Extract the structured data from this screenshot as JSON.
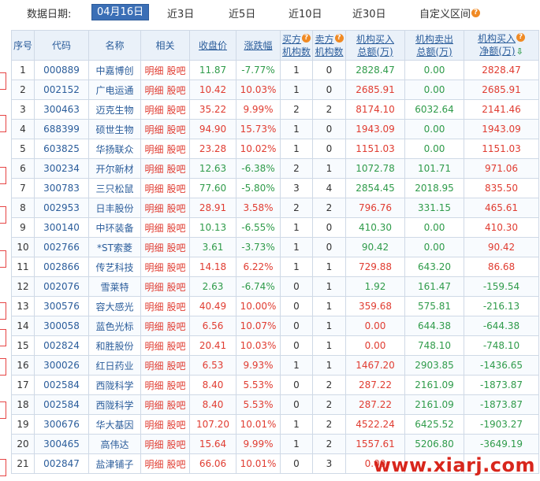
{
  "topbar": {
    "label": "数据日期:",
    "options": [
      {
        "label": "04月16日",
        "active": true
      },
      {
        "label": "近3日",
        "active": false
      },
      {
        "label": "近5日",
        "active": false
      },
      {
        "label": "近10日",
        "active": false
      },
      {
        "label": "近30日",
        "active": false
      },
      {
        "label": "自定义区间",
        "active": false
      }
    ]
  },
  "table": {
    "headers": {
      "seq": "序号",
      "code": "代码",
      "name": "名称",
      "related": "相关",
      "close": "收盘价",
      "change": "涨跌幅",
      "buy_count_1": "买方",
      "buy_count_2": "机构数",
      "sell_count_1": "卖方",
      "sell_count_2": "机构数",
      "buy_amt_1": "机构买入",
      "buy_amt_2": "总额(万)",
      "sell_amt_1": "机构卖出",
      "sell_amt_2": "总额(万)",
      "net_1": "机构买入",
      "net_2": "净额(万)"
    },
    "related_links": [
      "明细",
      "股吧"
    ],
    "rows": [
      {
        "seq": "1",
        "code": "000889",
        "name": "中嘉博创",
        "close": "11.87",
        "change": "-7.77%",
        "buyers": "1",
        "sellers": "0",
        "buy": "2828.47",
        "sell": "0.00",
        "net": "2828.47"
      },
      {
        "seq": "2",
        "code": "002152",
        "name": "广电运通",
        "close": "10.42",
        "change": "10.03%",
        "buyers": "1",
        "sellers": "0",
        "buy": "2685.91",
        "sell": "0.00",
        "net": "2685.91"
      },
      {
        "seq": "3",
        "code": "300463",
        "name": "迈克生物",
        "close": "35.22",
        "change": "9.99%",
        "buyers": "2",
        "sellers": "2",
        "buy": "8174.10",
        "sell": "6032.64",
        "net": "2141.46"
      },
      {
        "seq": "4",
        "code": "688399",
        "name": "硕世生物",
        "close": "94.90",
        "change": "15.73%",
        "buyers": "1",
        "sellers": "0",
        "buy": "1943.09",
        "sell": "0.00",
        "net": "1943.09"
      },
      {
        "seq": "5",
        "code": "603825",
        "name": "华扬联众",
        "close": "23.28",
        "change": "10.02%",
        "buyers": "1",
        "sellers": "0",
        "buy": "1151.03",
        "sell": "0.00",
        "net": "1151.03"
      },
      {
        "seq": "6",
        "code": "300234",
        "name": "开尔新材",
        "close": "12.63",
        "change": "-6.38%",
        "buyers": "2",
        "sellers": "1",
        "buy": "1072.78",
        "sell": "101.71",
        "net": "971.06"
      },
      {
        "seq": "7",
        "code": "300783",
        "name": "三只松鼠",
        "close": "77.60",
        "change": "-5.80%",
        "buyers": "3",
        "sellers": "4",
        "buy": "2854.45",
        "sell": "2018.95",
        "net": "835.50"
      },
      {
        "seq": "8",
        "code": "002953",
        "name": "日丰股份",
        "close": "28.91",
        "change": "3.58%",
        "buyers": "2",
        "sellers": "2",
        "buy": "796.76",
        "sell": "331.15",
        "net": "465.61"
      },
      {
        "seq": "9",
        "code": "300140",
        "name": "中环装备",
        "close": "10.13",
        "change": "-6.55%",
        "buyers": "1",
        "sellers": "0",
        "buy": "410.30",
        "sell": "0.00",
        "net": "410.30"
      },
      {
        "seq": "10",
        "code": "002766",
        "name": "*ST索菱",
        "close": "3.61",
        "change": "-3.73%",
        "buyers": "1",
        "sellers": "0",
        "buy": "90.42",
        "sell": "0.00",
        "net": "90.42"
      },
      {
        "seq": "11",
        "code": "002866",
        "name": "传艺科技",
        "close": "14.18",
        "change": "6.22%",
        "buyers": "1",
        "sellers": "1",
        "buy": "729.88",
        "sell": "643.20",
        "net": "86.68"
      },
      {
        "seq": "12",
        "code": "002076",
        "name": "雪莱特",
        "close": "2.63",
        "change": "-6.74%",
        "buyers": "0",
        "sellers": "1",
        "buy": "1.92",
        "sell": "161.47",
        "net": "-159.54"
      },
      {
        "seq": "13",
        "code": "300576",
        "name": "容大感光",
        "close": "40.49",
        "change": "10.00%",
        "buyers": "0",
        "sellers": "1",
        "buy": "359.68",
        "sell": "575.81",
        "net": "-216.13"
      },
      {
        "seq": "14",
        "code": "300058",
        "name": "蓝色光标",
        "close": "6.56",
        "change": "10.07%",
        "buyers": "0",
        "sellers": "1",
        "buy": "0.00",
        "sell": "644.38",
        "net": "-644.38"
      },
      {
        "seq": "15",
        "code": "002824",
        "name": "和胜股份",
        "close": "20.41",
        "change": "10.03%",
        "buyers": "0",
        "sellers": "1",
        "buy": "0.00",
        "sell": "748.10",
        "net": "-748.10"
      },
      {
        "seq": "16",
        "code": "300026",
        "name": "红日药业",
        "close": "6.53",
        "change": "9.93%",
        "buyers": "1",
        "sellers": "1",
        "buy": "1467.20",
        "sell": "2903.85",
        "net": "-1436.65"
      },
      {
        "seq": "17",
        "code": "002584",
        "name": "西陇科学",
        "close": "8.40",
        "change": "5.53%",
        "buyers": "0",
        "sellers": "2",
        "buy": "287.22",
        "sell": "2161.09",
        "net": "-1873.87"
      },
      {
        "seq": "18",
        "code": "002584",
        "name": "西陇科学",
        "close": "8.40",
        "change": "5.53%",
        "buyers": "0",
        "sellers": "2",
        "buy": "287.22",
        "sell": "2161.09",
        "net": "-1873.87"
      },
      {
        "seq": "19",
        "code": "300676",
        "name": "华大基因",
        "close": "107.20",
        "change": "10.01%",
        "buyers": "1",
        "sellers": "2",
        "buy": "4522.24",
        "sell": "6425.52",
        "net": "-1903.27"
      },
      {
        "seq": "20",
        "code": "300465",
        "name": "高伟达",
        "close": "15.64",
        "change": "9.99%",
        "buyers": "1",
        "sellers": "2",
        "buy": "1557.61",
        "sell": "5206.80",
        "net": "-3649.19"
      },
      {
        "seq": "21",
        "code": "002847",
        "name": "盐津铺子",
        "close": "66.06",
        "change": "10.01%",
        "buyers": "0",
        "sellers": "3",
        "buy": "0.00",
        "sell": "",
        "net": ""
      }
    ]
  },
  "watermark": "www.xiarj.com",
  "colors": {
    "up": "#e03c31",
    "down": "#2f9b4a",
    "accent": "#3b6fb6",
    "header_text": "#2b5d9b"
  }
}
